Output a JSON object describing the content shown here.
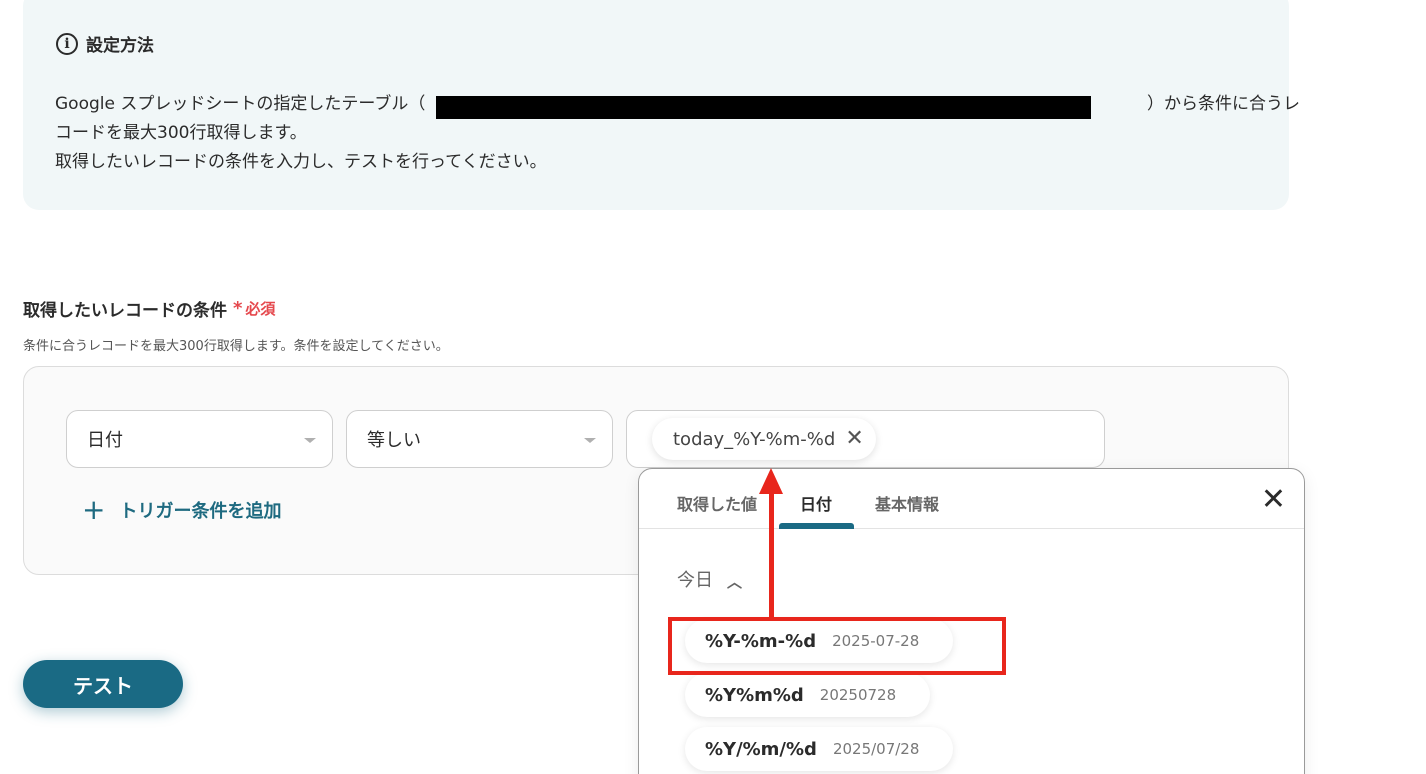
{
  "info": {
    "title": "設定方法",
    "icon": "info-icon",
    "line1_prefix": "Google スプレッドシートの指定したテーブル（",
    "line1_suffix": "）から条件に合うレ",
    "line2": "コードを最大300行取得します。",
    "line3": "取得したいレコードの条件を入力し、テストを行ってください。"
  },
  "field": {
    "label": "取得したいレコードの条件",
    "required_mark": "*",
    "required_text": "必須",
    "description": "条件に合うレコードを最大300行取得します。条件を設定してください。"
  },
  "condition": {
    "column_select": "日付",
    "operator_select": "等しい",
    "value_chip": "today_%Y-%m-%d",
    "add_trigger_label": "トリガー条件を追加"
  },
  "test_button": "テスト",
  "dropdown": {
    "tabs": [
      "取得した値",
      "日付",
      "基本情報"
    ],
    "active_tab": "日付",
    "section_label": "今日",
    "formats": [
      {
        "code": "%Y-%m-%d",
        "sample": "2025-07-28"
      },
      {
        "code": "%Y%m%d",
        "sample": "20250728"
      },
      {
        "code": "%Y/%m/%d",
        "sample": "2025/07/28"
      }
    ]
  },
  "colors": {
    "accent": "#1a6a84",
    "required": "#e5484d",
    "annotation": "#e8261c",
    "info_bg": "#f1f7f8"
  }
}
